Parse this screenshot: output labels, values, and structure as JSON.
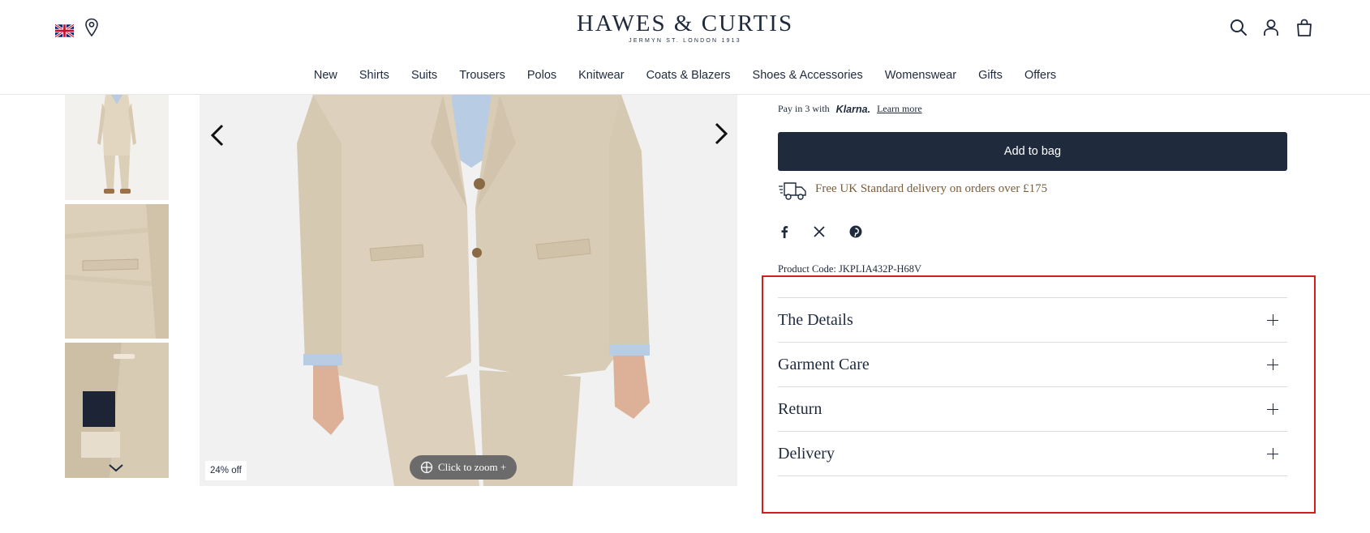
{
  "header": {
    "logo_main": "HAWES & CURTIS",
    "logo_sub": "JERMYN ST. LONDON 1913",
    "icons": [
      "uk-flag-icon",
      "location-pin-icon",
      "search-icon",
      "account-icon",
      "bag-icon"
    ]
  },
  "nav": {
    "items": [
      "New",
      "Shirts",
      "Suits",
      "Trousers",
      "Polos",
      "Knitwear",
      "Coats & Blazers",
      "Shoes & Accessories",
      "Womenswear",
      "Gifts",
      "Offers"
    ]
  },
  "gallery": {
    "badge": "24% off",
    "zoom_label": "Click to zoom +"
  },
  "product": {
    "klarna_prefix": "Pay in 3 with",
    "klarna_brand": "Klarna.",
    "klarna_link": "Learn more",
    "add_to_bag": "Add to bag",
    "delivery_text": "Free UK Standard delivery on orders over £175",
    "product_code": "Product Code: JKPLIA432P-H68V",
    "accordion": [
      "The Details",
      "Garment Care",
      "Return",
      "Delivery"
    ]
  },
  "colors": {
    "primary": "#1f2a3c",
    "delivery_text": "#7a5c38",
    "highlight_box": "#d81b1b"
  }
}
